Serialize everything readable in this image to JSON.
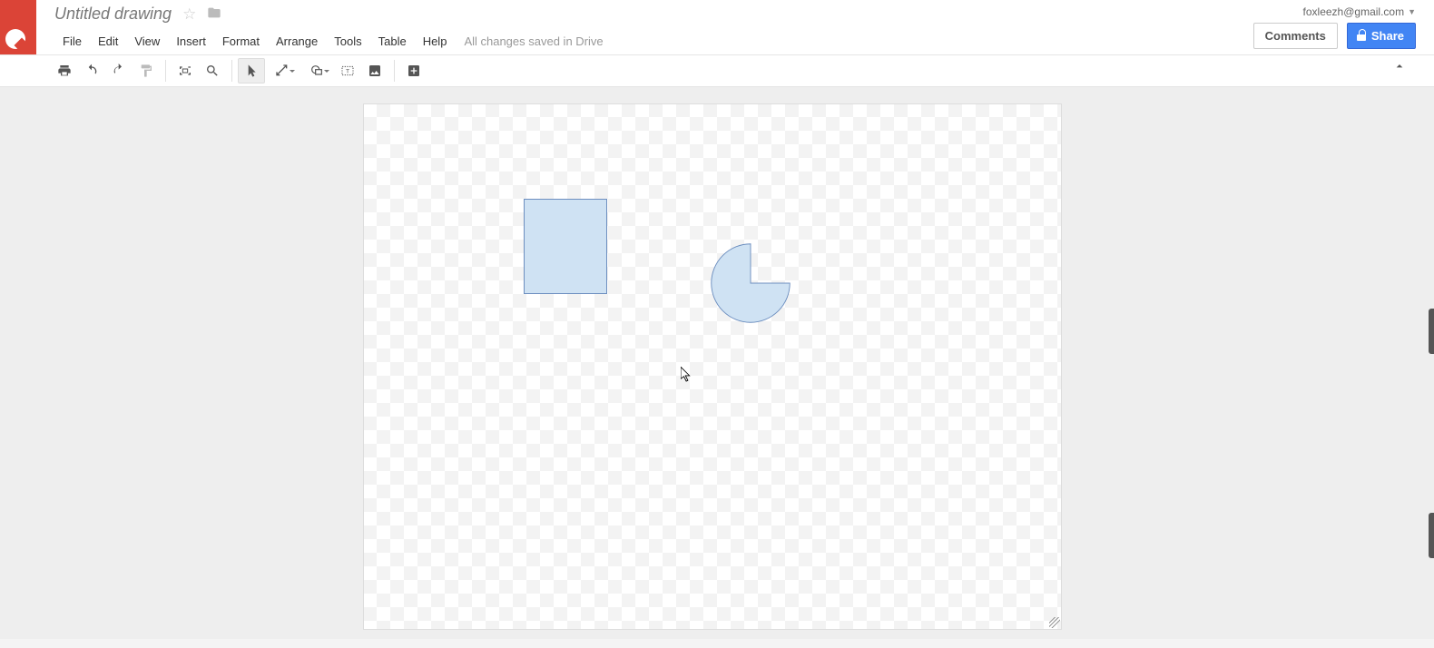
{
  "header": {
    "doc_title": "Untitled drawing",
    "account_email": "foxleezh@gmail.com",
    "comments_label": "Comments",
    "share_label": "Share"
  },
  "menu": {
    "items": [
      "File",
      "Edit",
      "View",
      "Insert",
      "Format",
      "Arrange",
      "Tools",
      "Table",
      "Help"
    ],
    "save_status": "All changes saved in Drive"
  },
  "toolbar": {
    "buttons": [
      {
        "name": "print-icon"
      },
      {
        "name": "undo-icon"
      },
      {
        "name": "redo-icon"
      },
      {
        "name": "paint-format-icon"
      },
      {
        "name": "fit-icon",
        "sep_before": true
      },
      {
        "name": "zoom-icon"
      },
      {
        "name": "select-icon",
        "sep_before": true,
        "active": true
      },
      {
        "name": "line-icon",
        "dd": true
      },
      {
        "name": "shape-icon",
        "dd": true
      },
      {
        "name": "textbox-icon"
      },
      {
        "name": "image-icon"
      },
      {
        "name": "insert-icon",
        "sep_before": true
      }
    ]
  },
  "canvas": {
    "shapes": [
      {
        "type": "rectangle",
        "name": "rectangle-shape"
      },
      {
        "type": "pie",
        "name": "pie-shape"
      }
    ]
  }
}
